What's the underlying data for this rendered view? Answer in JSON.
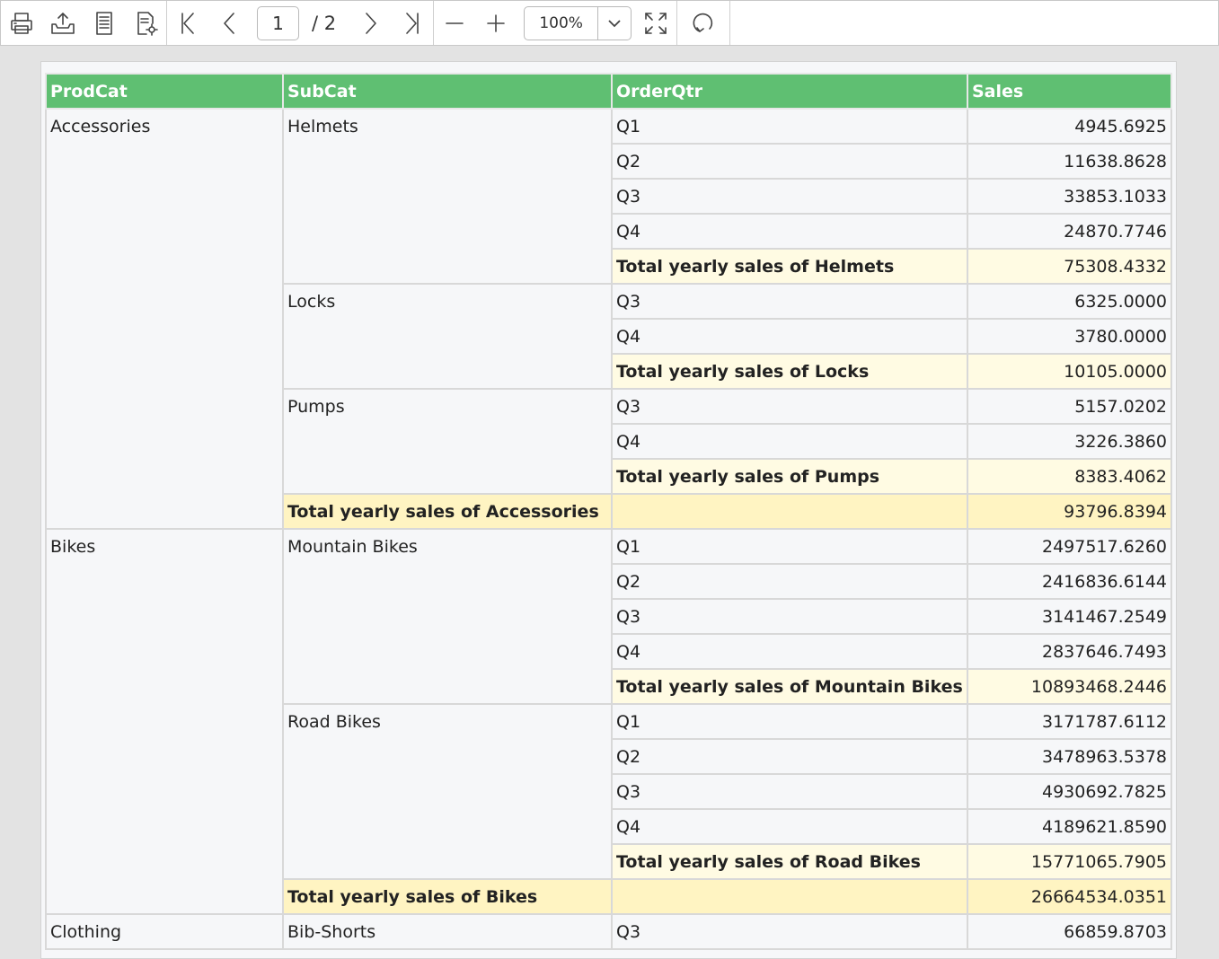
{
  "toolbar": {
    "current_page": "1",
    "total_pages": "/ 2",
    "zoom": "100%",
    "icons": [
      "print-icon",
      "export-icon",
      "page-setup-icon",
      "document-settings-icon",
      "first-page-icon",
      "previous-page-icon",
      "next-page-icon",
      "last-page-icon",
      "zoom-out-icon",
      "zoom-in-icon",
      "fit-to-page-icon",
      "refresh-icon"
    ]
  },
  "report": {
    "columns": [
      "ProdCat",
      "SubCat",
      "OrderQtr",
      "Sales"
    ],
    "accessories": {
      "category": "Accessories",
      "helmets": {
        "name": "Helmets",
        "rows": [
          [
            "Q1",
            "4945.6925"
          ],
          [
            "Q2",
            "11638.8628"
          ],
          [
            "Q3",
            "33853.1033"
          ],
          [
            "Q4",
            "24870.7746"
          ]
        ],
        "total_label": "Total yearly sales of Helmets",
        "total_value": "75308.4332"
      },
      "locks": {
        "name": "Locks",
        "rows": [
          [
            "Q3",
            "6325.0000"
          ],
          [
            "Q4",
            "3780.0000"
          ]
        ],
        "total_label": "Total yearly sales of Locks",
        "total_value": "10105.0000"
      },
      "pumps": {
        "name": "Pumps",
        "rows": [
          [
            "Q3",
            "5157.0202"
          ],
          [
            "Q4",
            "3226.3860"
          ]
        ],
        "total_label": "Total yearly sales of Pumps",
        "total_value": "8383.4062"
      },
      "total_label": "Total yearly sales of Accessories",
      "total_value": "93796.8394"
    },
    "bikes": {
      "category": "Bikes",
      "mountain": {
        "name": "Mountain Bikes",
        "rows": [
          [
            "Q1",
            "2497517.6260"
          ],
          [
            "Q2",
            "2416836.6144"
          ],
          [
            "Q3",
            "3141467.2549"
          ],
          [
            "Q4",
            "2837646.7493"
          ]
        ],
        "total_label": "Total yearly sales of Mountain Bikes",
        "total_value": "10893468.2446"
      },
      "road": {
        "name": "Road Bikes",
        "rows": [
          [
            "Q1",
            "3171787.6112"
          ],
          [
            "Q2",
            "3478963.5378"
          ],
          [
            "Q3",
            "4930692.7825"
          ],
          [
            "Q4",
            "4189621.8590"
          ]
        ],
        "total_label": "Total yearly sales of Road Bikes",
        "total_value": "15771065.7905"
      },
      "total_label": "Total yearly sales of Bikes",
      "total_value": "26664534.0351"
    },
    "clothing": {
      "category": "Clothing",
      "bib": {
        "name": "Bib-Shorts",
        "rows": [
          [
            "Q3",
            "66859.8703"
          ]
        ]
      }
    }
  }
}
